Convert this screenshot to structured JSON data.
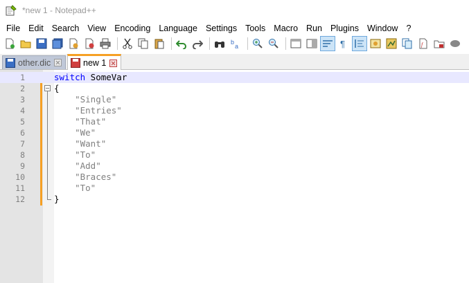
{
  "window": {
    "title": "*new 1 - Notepad++"
  },
  "menu": [
    "File",
    "Edit",
    "Search",
    "View",
    "Encoding",
    "Language",
    "Settings",
    "Tools",
    "Macro",
    "Run",
    "Plugins",
    "Window",
    "?"
  ],
  "tabs": [
    {
      "label": "other.dic",
      "active": false
    },
    {
      "label": "new 1",
      "active": true
    }
  ],
  "editor": {
    "lines": [
      {
        "num": "1",
        "keyword": "switch",
        "text": " SomeVar"
      },
      {
        "num": "2",
        "keyword": "",
        "text": "{"
      },
      {
        "num": "3",
        "keyword": "",
        "text": "    \"Single\""
      },
      {
        "num": "4",
        "keyword": "",
        "text": "    \"Entries\""
      },
      {
        "num": "5",
        "keyword": "",
        "text": "    \"That\""
      },
      {
        "num": "6",
        "keyword": "",
        "text": "    \"We\""
      },
      {
        "num": "7",
        "keyword": "",
        "text": "    \"Want\""
      },
      {
        "num": "8",
        "keyword": "",
        "text": "    \"To\""
      },
      {
        "num": "9",
        "keyword": "",
        "text": "    \"Add\""
      },
      {
        "num": "10",
        "keyword": "",
        "text": "    \"Braces\""
      },
      {
        "num": "11",
        "keyword": "",
        "text": "    \"To\""
      },
      {
        "num": "12",
        "keyword": "",
        "text": "}"
      }
    ]
  },
  "colors": {
    "keyword": "#0000ff",
    "string": "#808080",
    "accent": "#f6a024",
    "current_line": "#e8e8ff"
  }
}
